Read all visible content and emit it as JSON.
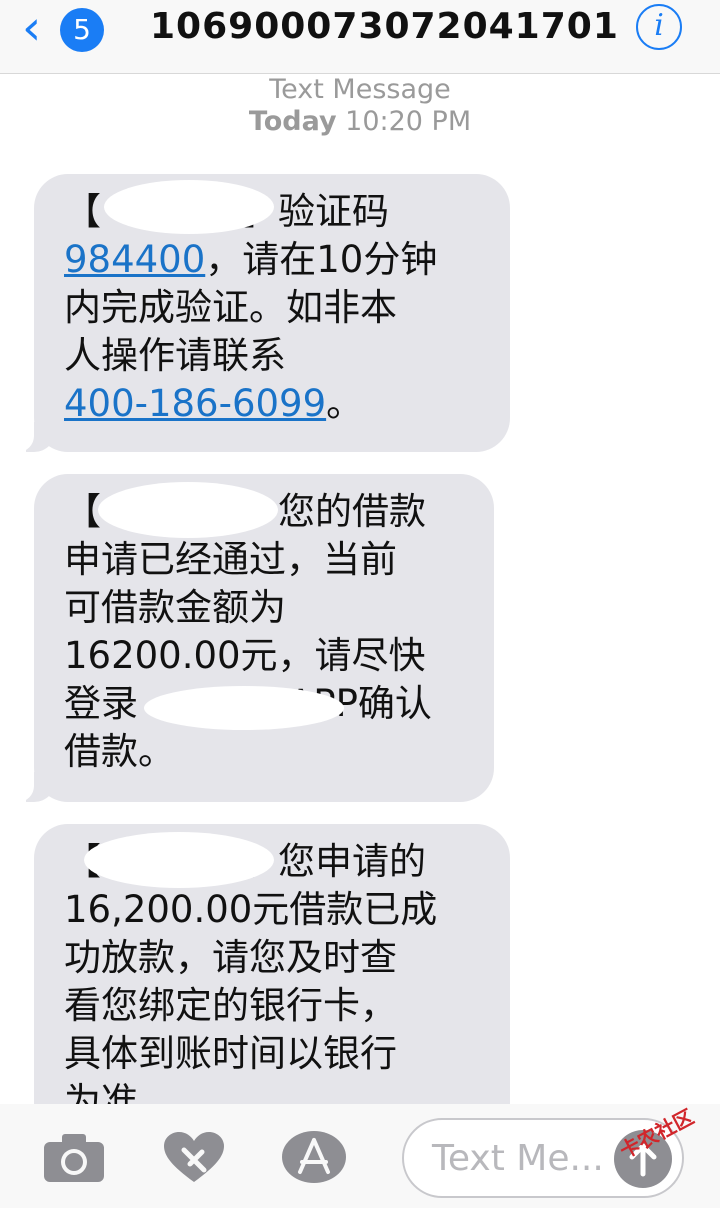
{
  "header": {
    "back_count": "5",
    "contact": "106900073072041701",
    "info_icon": "i"
  },
  "meta": {
    "type_label": "Text Message",
    "day": "Today",
    "time": "10:20 PM"
  },
  "messages": [
    {
      "pre": "【",
      "post": "】验证码",
      "code": "984400",
      "mid": "，请在10分钟\n内完成验证。如非本\n人操作请联系\n",
      "phone": "400-186-6099",
      "end": "。"
    },
    {
      "pre": "【",
      "post": "】您的借款\n申请已经通过，当前\n可借款金额为\n16200.00元，请尽快\n登录",
      "app": "APP确认\n借款。"
    },
    {
      "pre": "【",
      "post": "】您申请的\n16,200.00元借款已成\n功放款，请您及时查\n看您绑定的银行卡，\n具体到账时间以银行\n为准"
    }
  ],
  "composer": {
    "placeholder": "Text Me..."
  },
  "watermark": "卡农社区",
  "colors": {
    "accent": "#1a7df5",
    "bubble": "#e5e5ea",
    "link": "#1a73c8"
  }
}
